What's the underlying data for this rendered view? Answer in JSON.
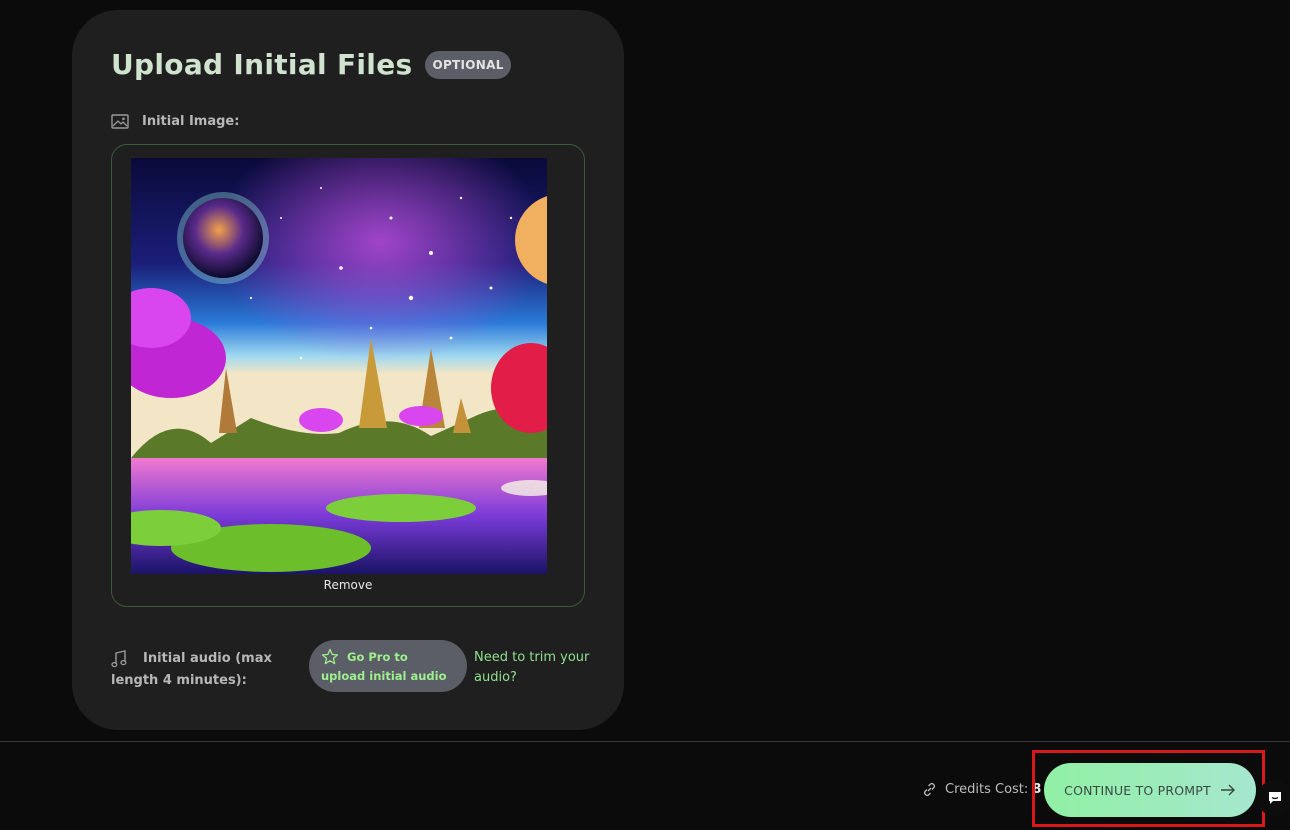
{
  "upload": {
    "title": "Upload Initial Files",
    "badge": "OPTIONAL",
    "initial_image_label": "Initial Image:",
    "remove_label": "Remove",
    "audio_label": "Initial audio (max length 4 minutes):",
    "gopro_label": "Go Pro to upload initial audio",
    "trim_link": "Need to trim your audio?"
  },
  "footer": {
    "credits_label": "Credits Cost:",
    "credits_value": "8",
    "continue_label": "CONTINUE TO PROMPT"
  },
  "colors": {
    "accent_green": "#9ef08f",
    "button_gradient_start": "#90f0a4",
    "button_gradient_end": "#a6e7cf",
    "highlight_red": "#d9181b"
  },
  "icons": [
    "image-icon",
    "music-note-icon",
    "star-icon",
    "link-icon",
    "arrow-right-icon",
    "chat-icon"
  ]
}
